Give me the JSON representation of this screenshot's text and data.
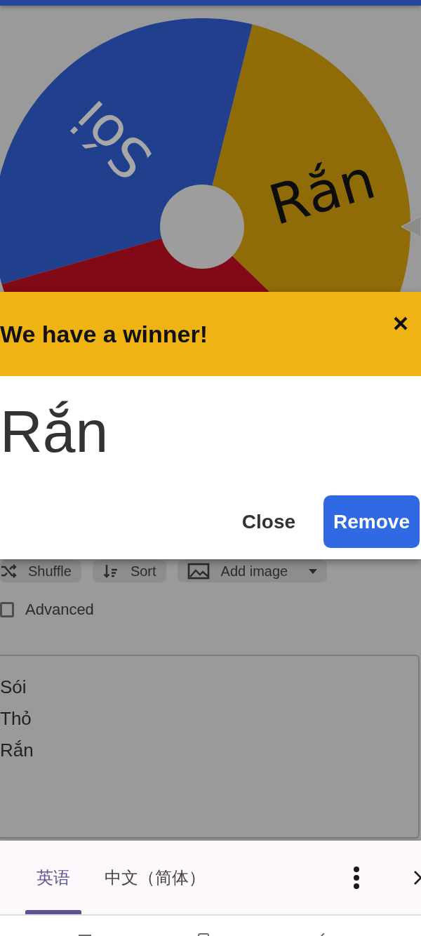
{
  "wheel": {
    "slices": [
      {
        "label": "Sói",
        "color": "#203f8c"
      },
      {
        "color": "#820a16"
      },
      {
        "label": "Rắn",
        "color": "#906c08"
      }
    ]
  },
  "toolbar": {
    "buttons": [
      {
        "label": "Shuffle",
        "kind": "shuffle",
        "dropdown": false
      },
      {
        "label": "Sort",
        "kind": "sort",
        "dropdown": false
      },
      {
        "label": "Add image",
        "kind": "image",
        "dropdown": true
      }
    ]
  },
  "advanced": {
    "label": "Advanced",
    "checked": false
  },
  "entries": {
    "lines": [
      "Sói",
      "Thỏ",
      "Rắn"
    ]
  },
  "winner_dialog": {
    "title": "We have a winner!",
    "winner": "Rắn",
    "buttons": [
      {
        "label": "Close",
        "kind": "flat"
      },
      {
        "label": "Remove",
        "kind": "filled"
      }
    ]
  },
  "translate_bar": {
    "tabs": [
      {
        "label": "英语",
        "selected": true
      },
      {
        "label": "中文（简体）",
        "selected": false
      }
    ]
  }
}
